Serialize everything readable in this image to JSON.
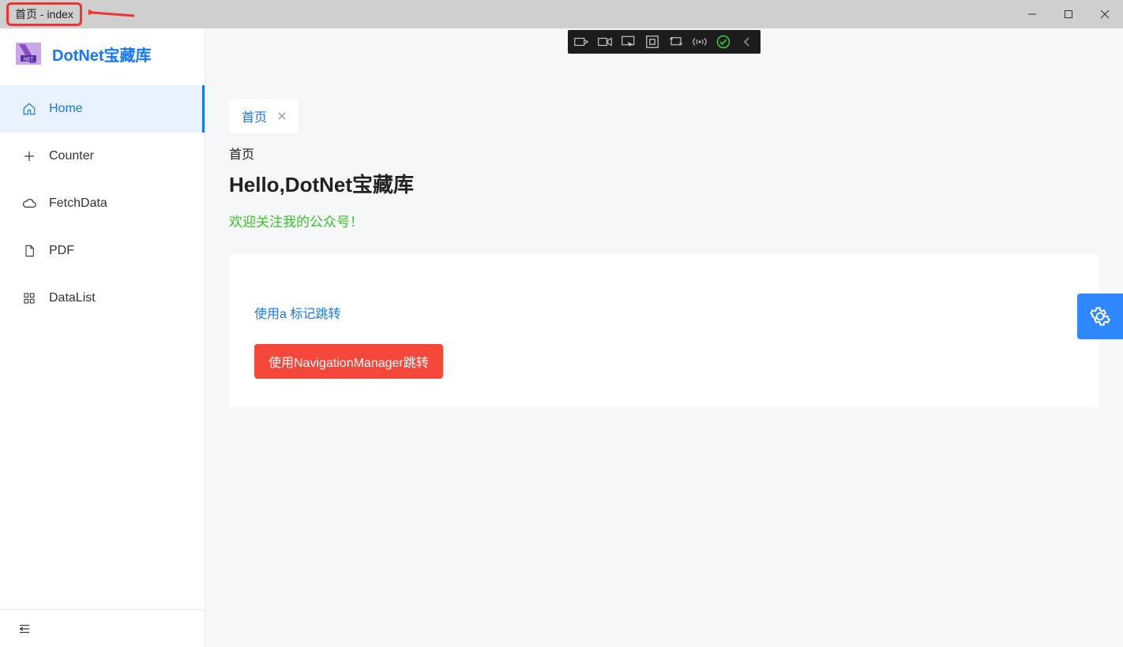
{
  "window": {
    "title": "首页 - index"
  },
  "sidebar": {
    "brand": "DotNet宝藏库",
    "items": [
      {
        "label": "Home",
        "icon": "home-icon",
        "active": true
      },
      {
        "label": "Counter",
        "icon": "plus-icon",
        "active": false
      },
      {
        "label": "FetchData",
        "icon": "cloud-icon",
        "active": false
      },
      {
        "label": "PDF",
        "icon": "file-icon",
        "active": false
      },
      {
        "label": "DataList",
        "icon": "grid-icon",
        "active": false
      }
    ]
  },
  "tabs": [
    {
      "label": "首页",
      "closable": true
    }
  ],
  "page": {
    "breadcrumb": "首页",
    "heading": "Hello,DotNet宝藏库",
    "welcome": "欢迎关注我的公众号！",
    "link_label": "使用a 标记跳转",
    "button_label": "使用NavigationManager跳转"
  },
  "colors": {
    "primary": "#1677ff",
    "danger": "#f5483b",
    "success": "#34c724"
  }
}
